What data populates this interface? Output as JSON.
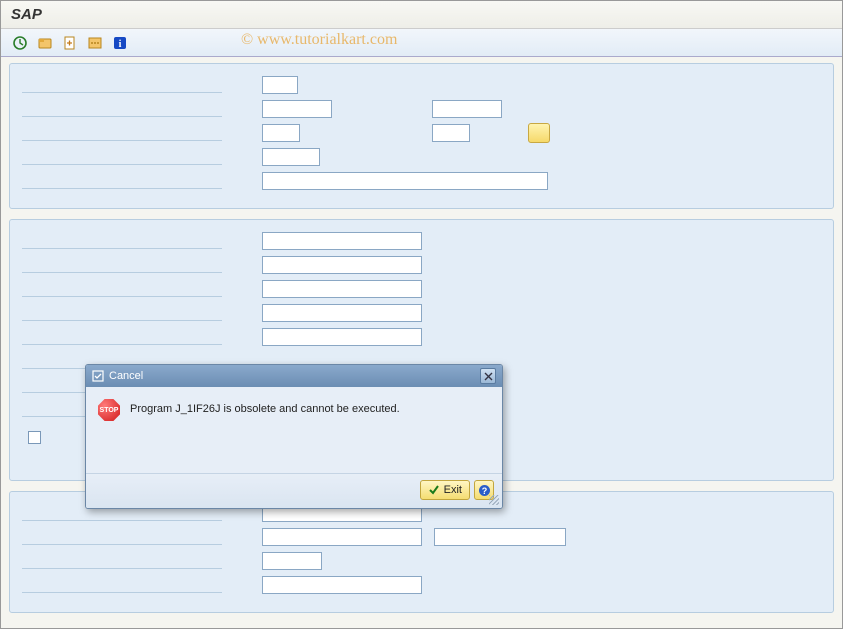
{
  "title": "SAP",
  "watermark": "© www.tutorialkart.com",
  "toolbar": {
    "items": [
      {
        "name": "execute-icon",
        "glyph": "clock",
        "color": "#2a7d2a"
      },
      {
        "name": "get-variant-icon",
        "glyph": "folder",
        "color": "#c47a1a"
      },
      {
        "name": "new-icon",
        "glyph": "doc",
        "color": "#c47a1a"
      },
      {
        "name": "save-icon",
        "glyph": "dots",
        "color": "#c47a1a"
      },
      {
        "name": "info-icon",
        "glyph": "info",
        "color": "#1649c4"
      }
    ]
  },
  "modal": {
    "title": "Cancel",
    "stop_label": "STOP",
    "message": "Program J_1IF26J is obsolete and cannot be executed.",
    "exit_label": "Exit"
  }
}
